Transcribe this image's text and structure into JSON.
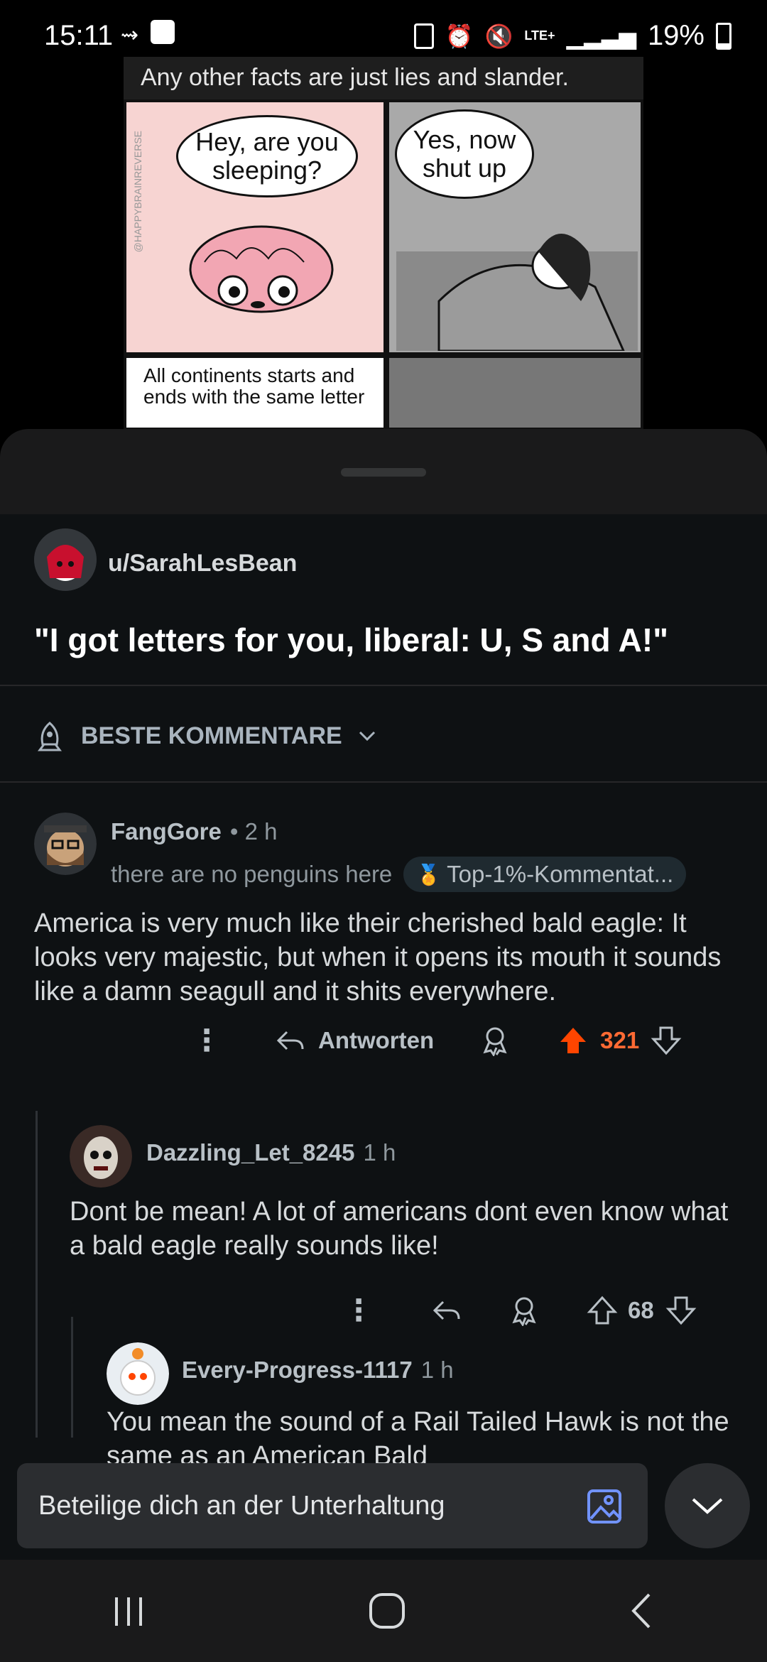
{
  "status_bar": {
    "time": "15:11",
    "battery": "19%",
    "network": "LTE+"
  },
  "meme": {
    "caption": "Any other facts are just lies and slander.",
    "bubble_left": "Hey, are you sleeping?",
    "bubble_right": "Yes, now shut up",
    "bottom_left": "All continents starts and ends with the same letter"
  },
  "post": {
    "author": "u/SarahLesBean",
    "title": "\"I got letters for you, liberal: U, S and A!\""
  },
  "sort": {
    "label": "BESTE KOMMENTARE"
  },
  "comments": [
    {
      "user": "FangGore",
      "time": "• 2 h",
      "flair_text": "there are no penguins here",
      "badge": "Top-1%-Kommentat...",
      "body": "America is very much like their cherished bald eagle: It looks very majestic, but when it opens its mouth it sounds like a damn seagull and it shits everywhere.",
      "reply_label": "Antworten",
      "votes": "321",
      "upvoted": true
    },
    {
      "user": "Dazzling_Let_8245",
      "time": "1 h",
      "body": "Dont be mean! A lot of americans dont even know what a bald eagle really sounds like!",
      "votes": "68"
    },
    {
      "user": "Every-Progress-1117",
      "time": "1 h",
      "body": "You mean the sound of a Rail Tailed Hawk is not the same as an American Bald"
    }
  ],
  "composer": {
    "placeholder": "Beteilige dich an der Unterhaltung"
  },
  "colors": {
    "upvote": "#ff4500",
    "background": "#0e1113",
    "sheet": "#1a1a1b"
  }
}
